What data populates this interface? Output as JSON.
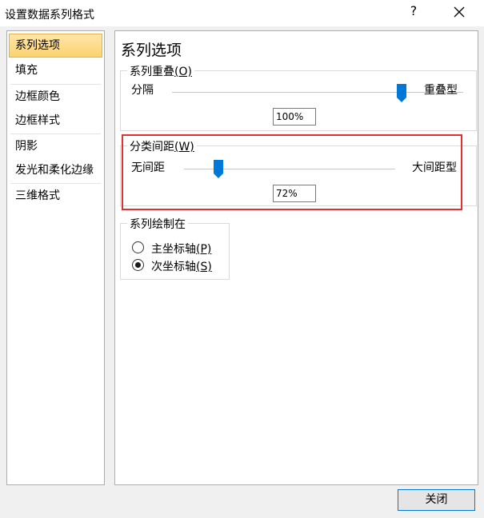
{
  "window": {
    "title": "设置数据系列格式",
    "help_label": "?",
    "close_footer_label": "关闭"
  },
  "nav": {
    "items": [
      {
        "label": "系列选项",
        "selected": true
      },
      {
        "label": "填充",
        "selected": false
      },
      {
        "label": "边框颜色",
        "selected": false
      },
      {
        "label": "边框样式",
        "selected": false
      },
      {
        "label": "阴影",
        "selected": false
      },
      {
        "label": "发光和柔化边缘",
        "selected": false
      },
      {
        "label": "三维格式",
        "selected": false
      }
    ]
  },
  "panel": {
    "title": "系列选项",
    "overlap": {
      "legend": "系列重叠",
      "hotkey": "(O)",
      "left_label": "分隔",
      "right_label": "重叠型",
      "value": "100%",
      "fraction": 1.0
    },
    "gap": {
      "legend": "分类间距",
      "hotkey": "(W)",
      "left_label": "无间距",
      "right_label": "大间距型",
      "value": "72%",
      "fraction": 0.16
    },
    "plot_on": {
      "legend": "系列绘制在",
      "options": [
        {
          "label": "主坐标轴",
          "hotkey": "(P)",
          "selected": false
        },
        {
          "label": "次坐标轴",
          "hotkey": "(S)",
          "selected": true
        }
      ]
    }
  },
  "colors": {
    "accent": "#0078d7",
    "highlight_border": "#e03030",
    "selected_nav": "#fbd26f"
  }
}
